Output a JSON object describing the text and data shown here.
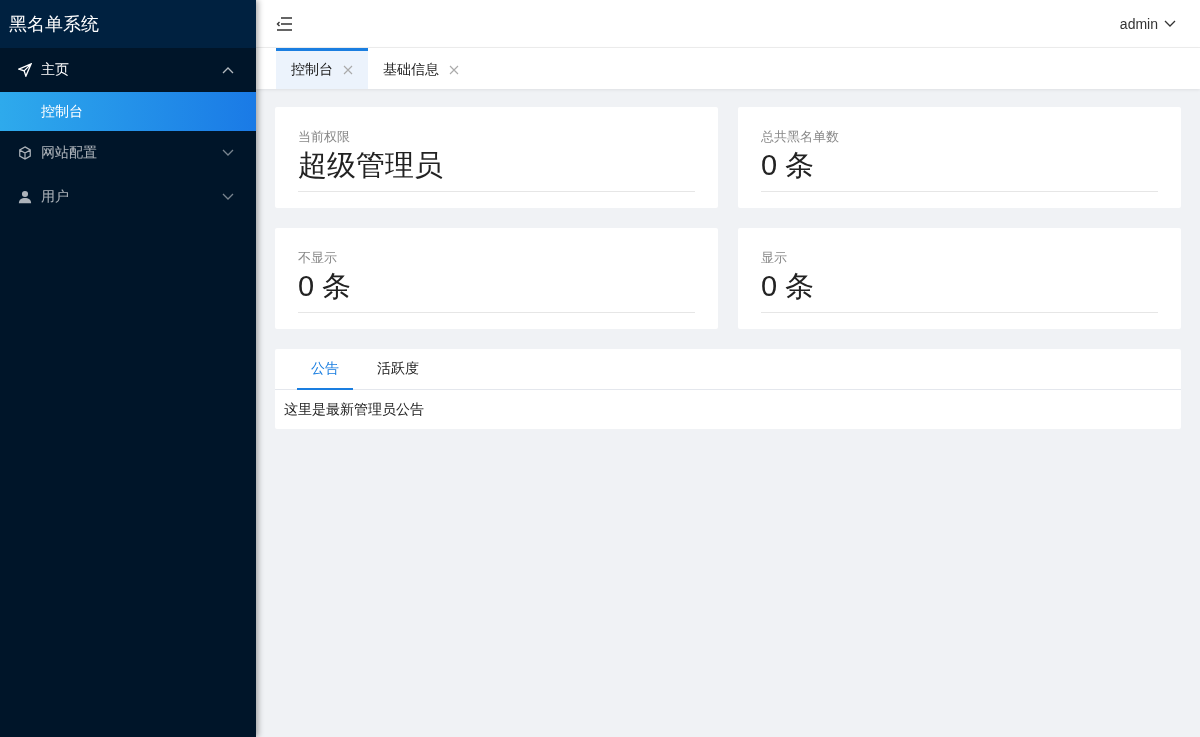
{
  "sidebar": {
    "title": "黑名单系统",
    "menu": [
      {
        "label": "主页",
        "kind": "send",
        "expanded": true,
        "children": [
          {
            "label": "控制台",
            "selected": true
          }
        ]
      },
      {
        "label": "网站配置",
        "kind": "cube",
        "expanded": false
      },
      {
        "label": "用户",
        "kind": "user",
        "expanded": false
      }
    ]
  },
  "header": {
    "user": "admin"
  },
  "tabs": [
    {
      "label": "控制台",
      "selected": true
    },
    {
      "label": "基础信息",
      "selected": false
    }
  ],
  "stats": [
    {
      "label": "当前权限",
      "value": "超级管理员"
    },
    {
      "label": "总共黑名单数",
      "value": "0 条"
    },
    {
      "label": "不显示",
      "value": "0 条"
    },
    {
      "label": "显示",
      "value": "0 条"
    }
  ],
  "notice": {
    "tabs": [
      {
        "label": "公告",
        "selected": true
      },
      {
        "label": "活跃度",
        "selected": false
      }
    ],
    "content": "这里是最新管理员公告"
  }
}
